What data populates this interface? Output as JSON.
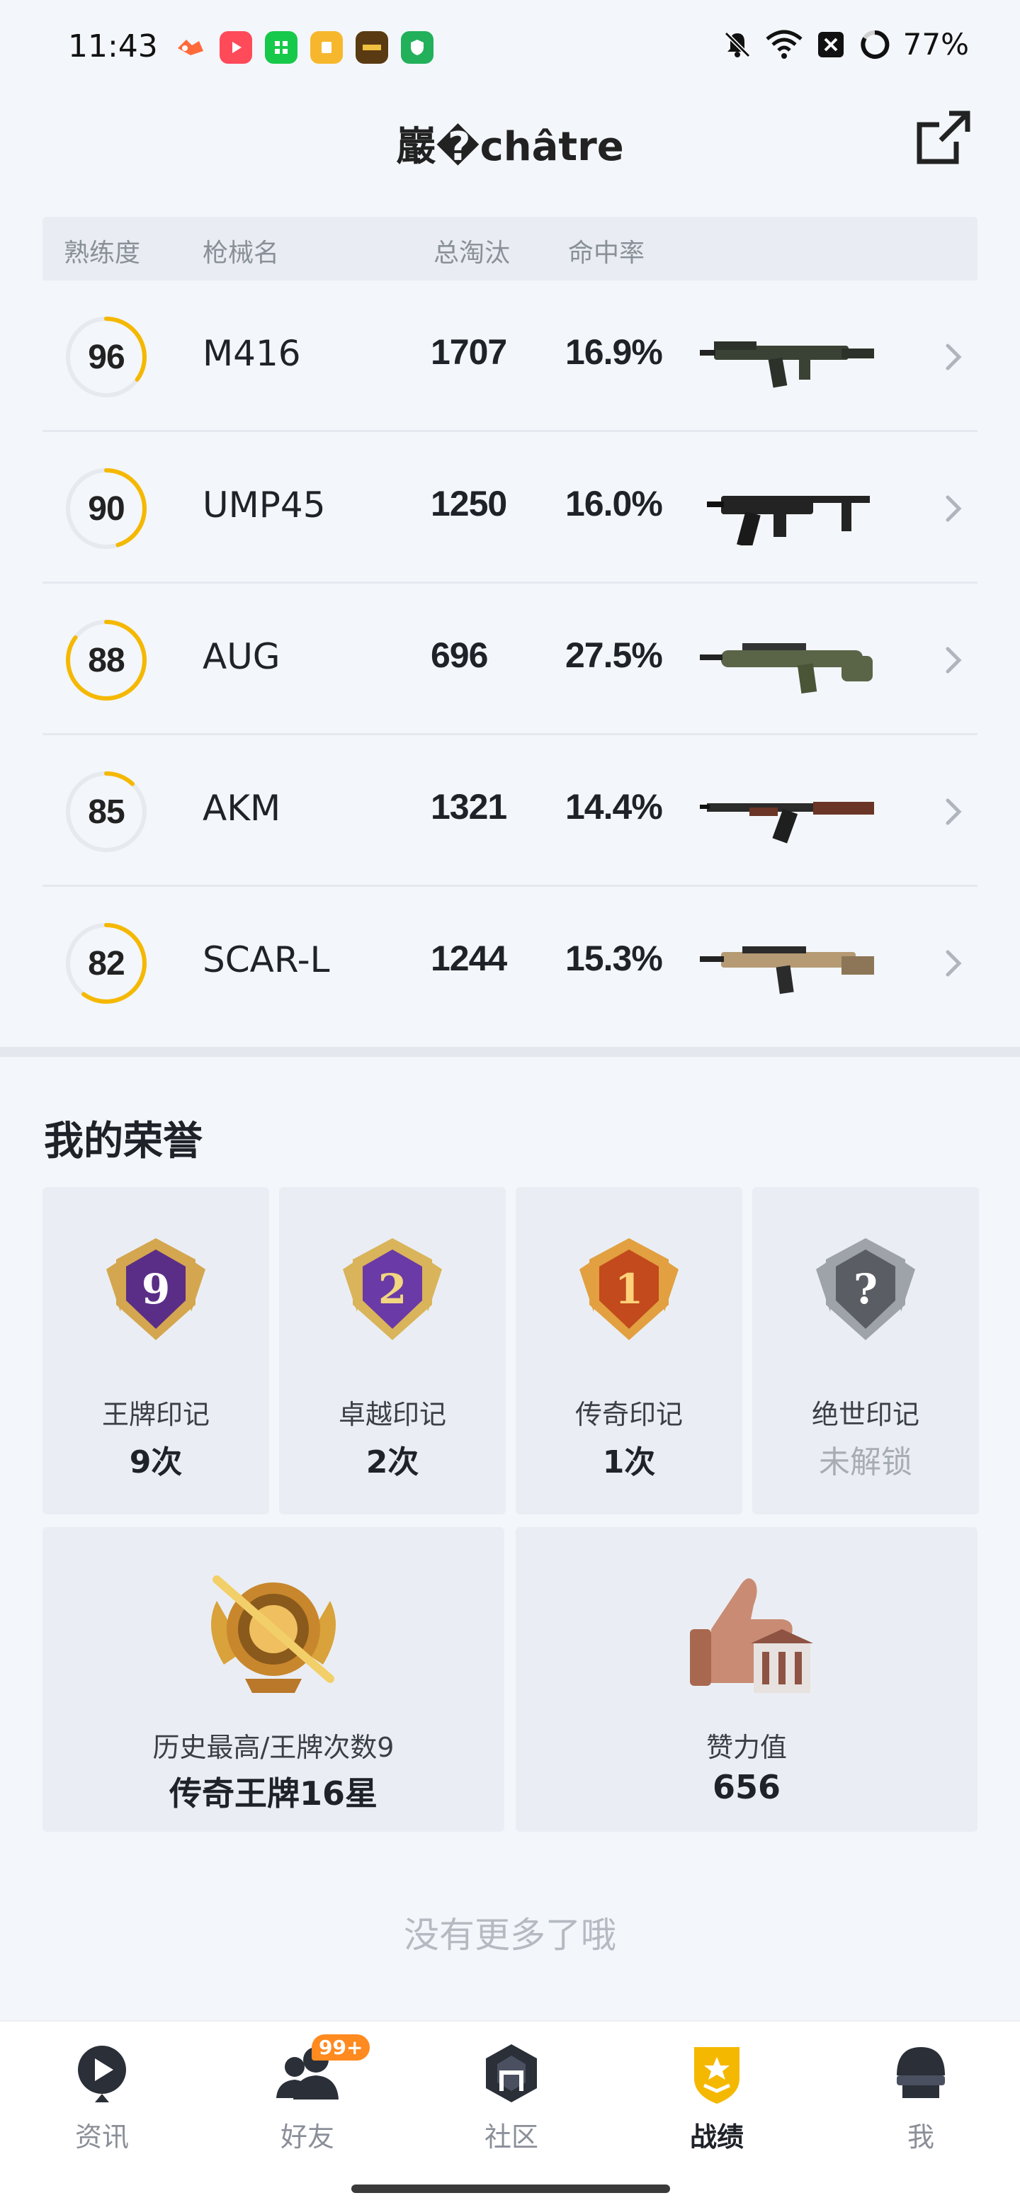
{
  "status_bar": {
    "time": "11:43",
    "battery": "77%",
    "icons": [
      "mute-bell-icon",
      "wifi-icon",
      "close-box-icon",
      "battery-ring-icon"
    ]
  },
  "header": {
    "title": "巖�châtre",
    "share_icon": "share-external-icon"
  },
  "table": {
    "headers": {
      "proficiency": "熟练度",
      "weapon_name": "枪械名",
      "total_kills": "总淘汰",
      "hit_rate": "命中率"
    },
    "ring_color": "#f5b800",
    "rows": [
      {
        "proficiency": "96",
        "level": 0.35,
        "name": "M416",
        "kills": "1707",
        "hit_rate": "16.9%",
        "gun": "m416"
      },
      {
        "proficiency": "90",
        "level": 0.45,
        "name": "UMP45",
        "kills": "1250",
        "hit_rate": "16.0%",
        "gun": "ump45"
      },
      {
        "proficiency": "88",
        "level": 0.85,
        "name": "AUG",
        "kills": "696",
        "hit_rate": "27.5%",
        "gun": "aug"
      },
      {
        "proficiency": "85",
        "level": 0.12,
        "name": "AKM",
        "kills": "1321",
        "hit_rate": "14.4%",
        "gun": "akm"
      },
      {
        "proficiency": "82",
        "level": 0.6,
        "name": "SCAR-L",
        "kills": "1244",
        "hit_rate": "15.3%",
        "gun": "scarl"
      }
    ]
  },
  "honors": {
    "title": "我的荣誉",
    "badges": [
      {
        "name": "王牌印记",
        "count": "9次",
        "number": "9",
        "locked": false
      },
      {
        "name": "卓越印记",
        "count": "2次",
        "number": "2",
        "locked": false
      },
      {
        "name": "传奇印记",
        "count": "1次",
        "number": "1",
        "locked": false
      },
      {
        "name": "绝世印记",
        "count": "未解锁",
        "number": "?",
        "locked": true
      }
    ],
    "highest": {
      "label": "历史最高/王牌次数9",
      "value": "传奇王牌16星"
    },
    "effort": {
      "label": "赞力值",
      "value": "656"
    }
  },
  "footer": {
    "no_more": "没有更多了哦"
  },
  "nav": {
    "items": [
      {
        "label": "资讯",
        "icon": "news-icon",
        "active": false
      },
      {
        "label": "好友",
        "icon": "friends-icon",
        "active": false,
        "badge": "99+"
      },
      {
        "label": "社区",
        "icon": "community-icon",
        "active": false
      },
      {
        "label": "战绩",
        "icon": "record-icon",
        "active": true
      },
      {
        "label": "我",
        "icon": "profile-icon",
        "active": false
      }
    ]
  }
}
